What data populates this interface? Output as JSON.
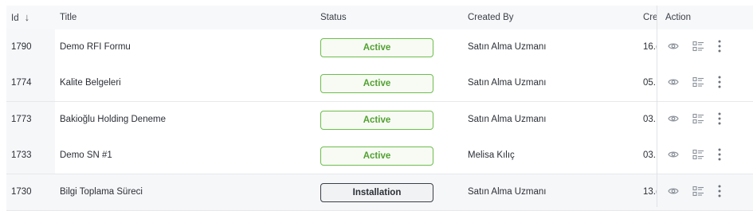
{
  "table": {
    "columns": {
      "id": "Id",
      "id_sort": "↓",
      "title": "Title",
      "status": "Status",
      "created_by": "Created By",
      "created": "Cre",
      "action": "Action"
    },
    "rows": [
      {
        "id": "1790",
        "title": "Demo RFI Formu",
        "status": "Active",
        "created_by": "Satın Alma Uzmanı",
        "created": "16.("
      },
      {
        "id": "1774",
        "title": "Kalite Belgeleri",
        "status": "Active",
        "created_by": "Satın Alma Uzmanı",
        "created": "05."
      },
      {
        "id": "1773",
        "title": "Bakioğlu Holding Deneme",
        "status": "Active",
        "created_by": "Satın Alma Uzmanı",
        "created": "03."
      },
      {
        "id": "1733",
        "title": "Demo SN #1",
        "status": "Active",
        "created_by": "Melisa Kılıç",
        "created": "03."
      },
      {
        "id": "1730",
        "title": "Bilgi Toplama Süreci",
        "status": "Installation",
        "created_by": "Satın Alma Uzmanı",
        "created": "13.("
      }
    ]
  },
  "icons": [
    "eye-icon",
    "list-details-icon",
    "more-vertical-icon"
  ],
  "colors": {
    "active_border": "#6dbd4d",
    "active_text": "#52a030",
    "installation_border": "#3a3f47",
    "header_bg": "#f7f8fa"
  }
}
